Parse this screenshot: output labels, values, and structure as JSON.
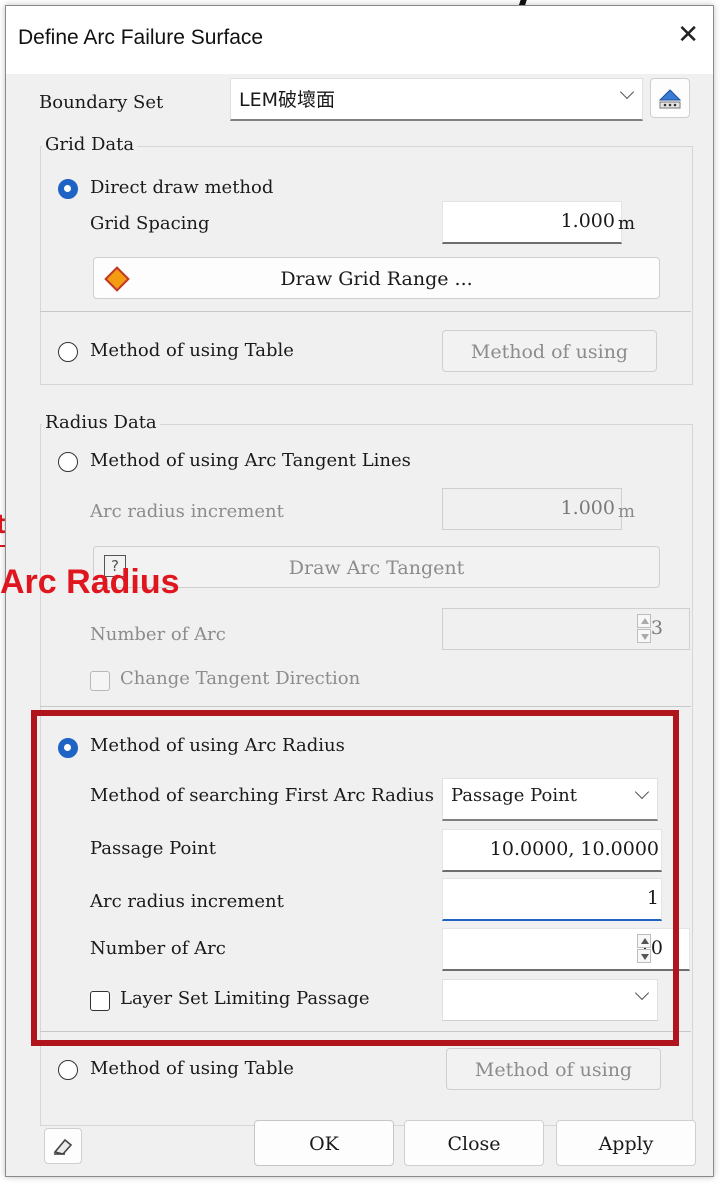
{
  "background": {
    "annotation_partial": "ta",
    "annotation_title": "Arc Radius"
  },
  "dialog": {
    "title": "Define Arc Failure Surface",
    "boundary_set": {
      "label": "Boundary Set",
      "value": "LEM破壞面"
    },
    "grid_data": {
      "group_title": "Grid Data",
      "direct_draw": {
        "label": "Direct draw method",
        "selected": true
      },
      "grid_spacing": {
        "label": "Grid Spacing",
        "value": "1.000",
        "unit": "m"
      },
      "draw_grid_button": "Draw Grid Range ...",
      "table_method": {
        "label": "Method of using Table",
        "selected": false,
        "button": "Method of using"
      }
    },
    "radius_data": {
      "group_title": "Radius Data",
      "tangent_lines": {
        "label": "Method of using Arc Tangent Lines",
        "selected": false,
        "increment_label": "Arc radius increment",
        "increment_value": "1.000",
        "increment_unit": "m",
        "draw_button": "Draw Arc Tangent",
        "number_label": "Number of Arc",
        "number_value": "3",
        "change_direction": "Change Tangent Direction"
      },
      "arc_radius": {
        "label": "Method of using Arc Radius",
        "selected": true,
        "search_label": "Method of searching First Arc Radius",
        "search_value": "Passage Point",
        "passage_label": "Passage Point",
        "passage_value": "10.0000, 10.0000",
        "increment_label": "Arc radius increment",
        "increment_value": "1",
        "number_label": "Number of Arc",
        "number_value": "10",
        "layer_set_label": "Layer Set Limiting Passage",
        "layer_set_value": ""
      },
      "table_method": {
        "label": "Method of using Table",
        "selected": false,
        "button": "Method of using"
      }
    },
    "buttons": {
      "ok": "OK",
      "close": "Close",
      "apply": "Apply"
    },
    "colors": {
      "highlight": "#b0141c",
      "accent": "#1f63c5",
      "annotation": "#e0161f"
    }
  }
}
